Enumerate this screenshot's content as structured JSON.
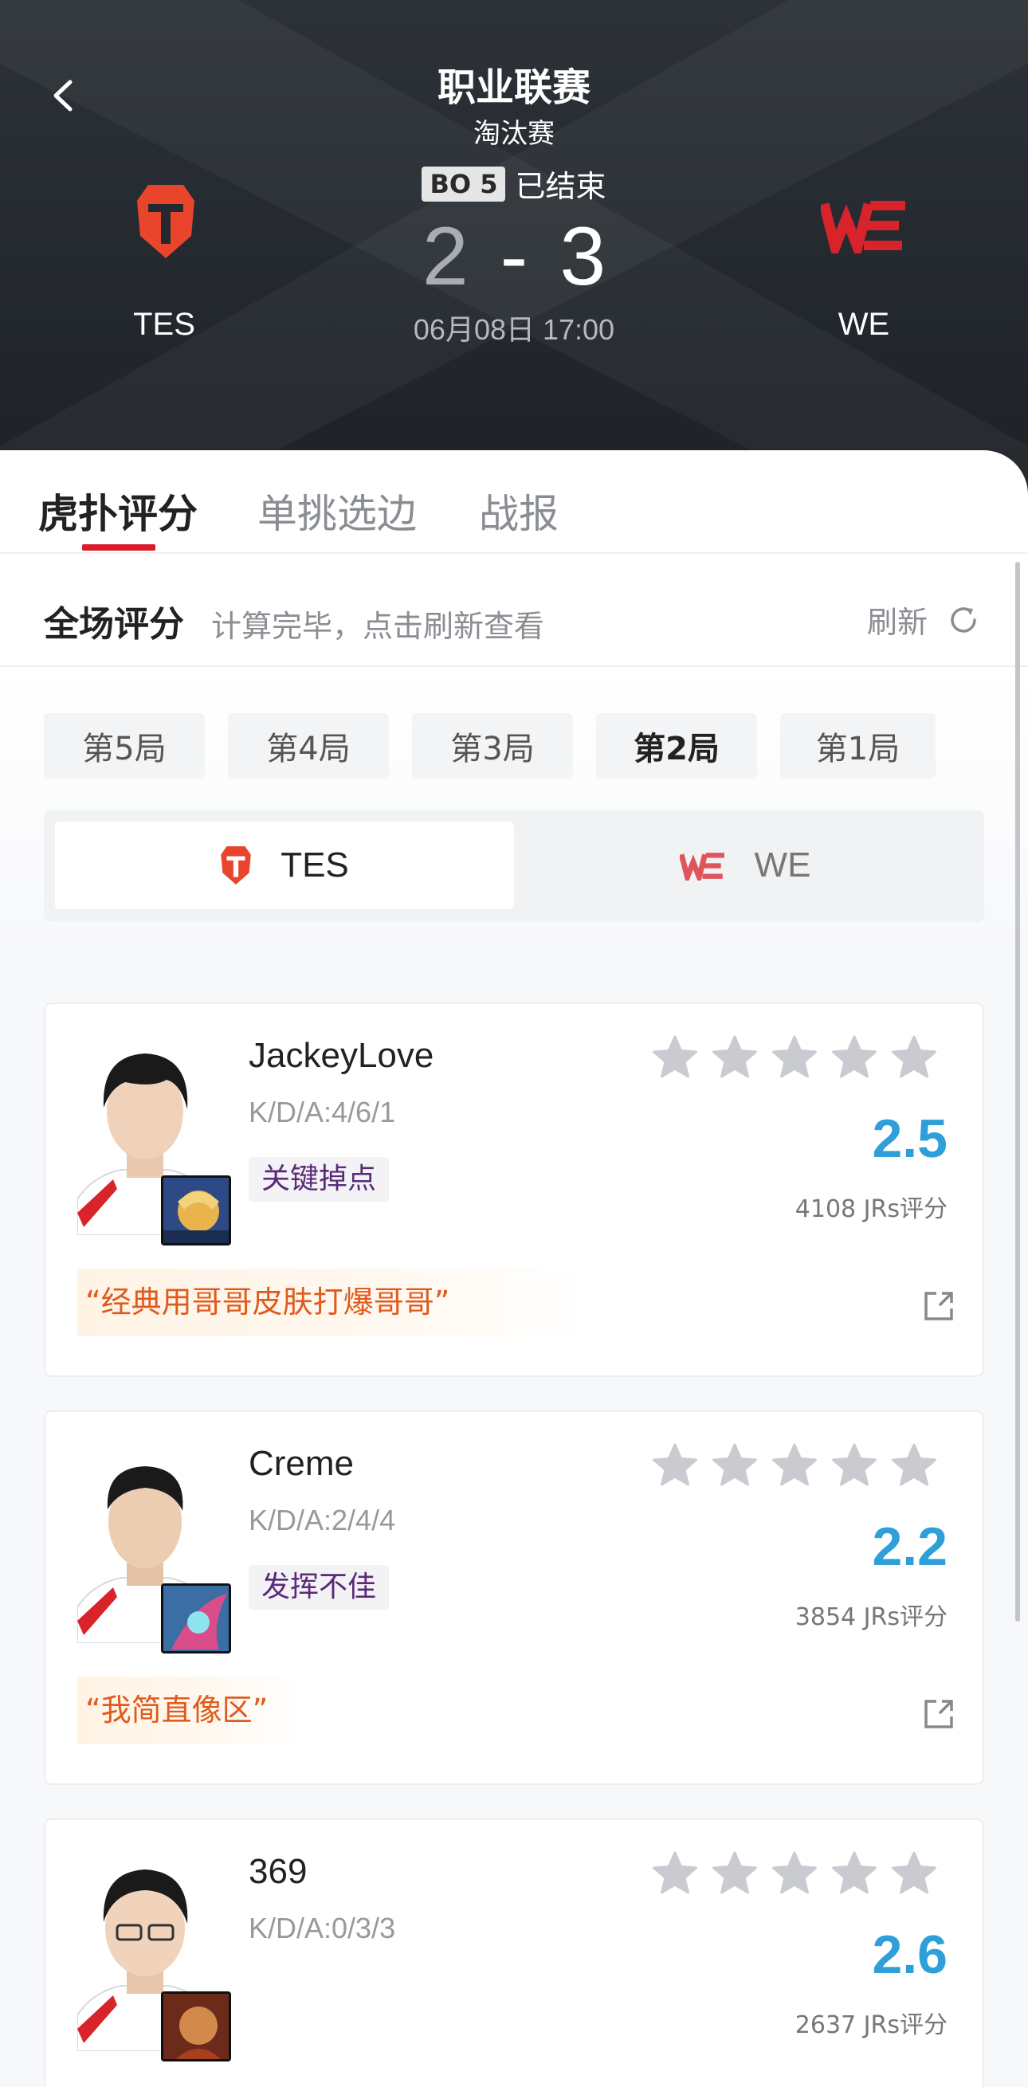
{
  "header": {
    "league": "职业联赛",
    "stage": "淘汰赛",
    "bo": "BO 5",
    "status": "已结束",
    "score_left": "2",
    "score_dash": "-",
    "score_right": "3",
    "time": "06月08日 17:00",
    "team_left": "TES",
    "team_right": "WE"
  },
  "tabs": [
    "虎扑评分",
    "单挑选边",
    "战报"
  ],
  "score_section": {
    "title": "全场评分",
    "subtitle": "计算完毕，点击刷新查看",
    "refresh": "刷新"
  },
  "games": [
    "第5局",
    "第4局",
    "第3局",
    "第2局",
    "第1局"
  ],
  "team_switch": {
    "left": "TES",
    "right": "WE"
  },
  "players": [
    {
      "name": "JackeyLove",
      "kda": "K/D/A:4/6/1",
      "tag": "关键掉点",
      "rating": "2.5",
      "votes": "4108 JRs评分",
      "quote": "“经典用哥哥皮肤打爆哥哥”"
    },
    {
      "name": "Creme",
      "kda": "K/D/A:2/4/4",
      "tag": "发挥不佳",
      "rating": "2.2",
      "votes": "3854 JRs评分",
      "quote": "“我简直像区”"
    },
    {
      "name": "369",
      "kda": "K/D/A:0/3/3",
      "rating": "2.6",
      "votes": "2637 JRs评分"
    }
  ],
  "colors": {
    "accent": "#d81e2c",
    "rating": "#2e9fd8",
    "quote": "#e05a1c",
    "tes": "#e8452c",
    "we": "#d8232a"
  },
  "icons": [
    "back-icon",
    "tes-logo",
    "we-logo",
    "refresh-icon",
    "star-icon",
    "share-icon"
  ]
}
